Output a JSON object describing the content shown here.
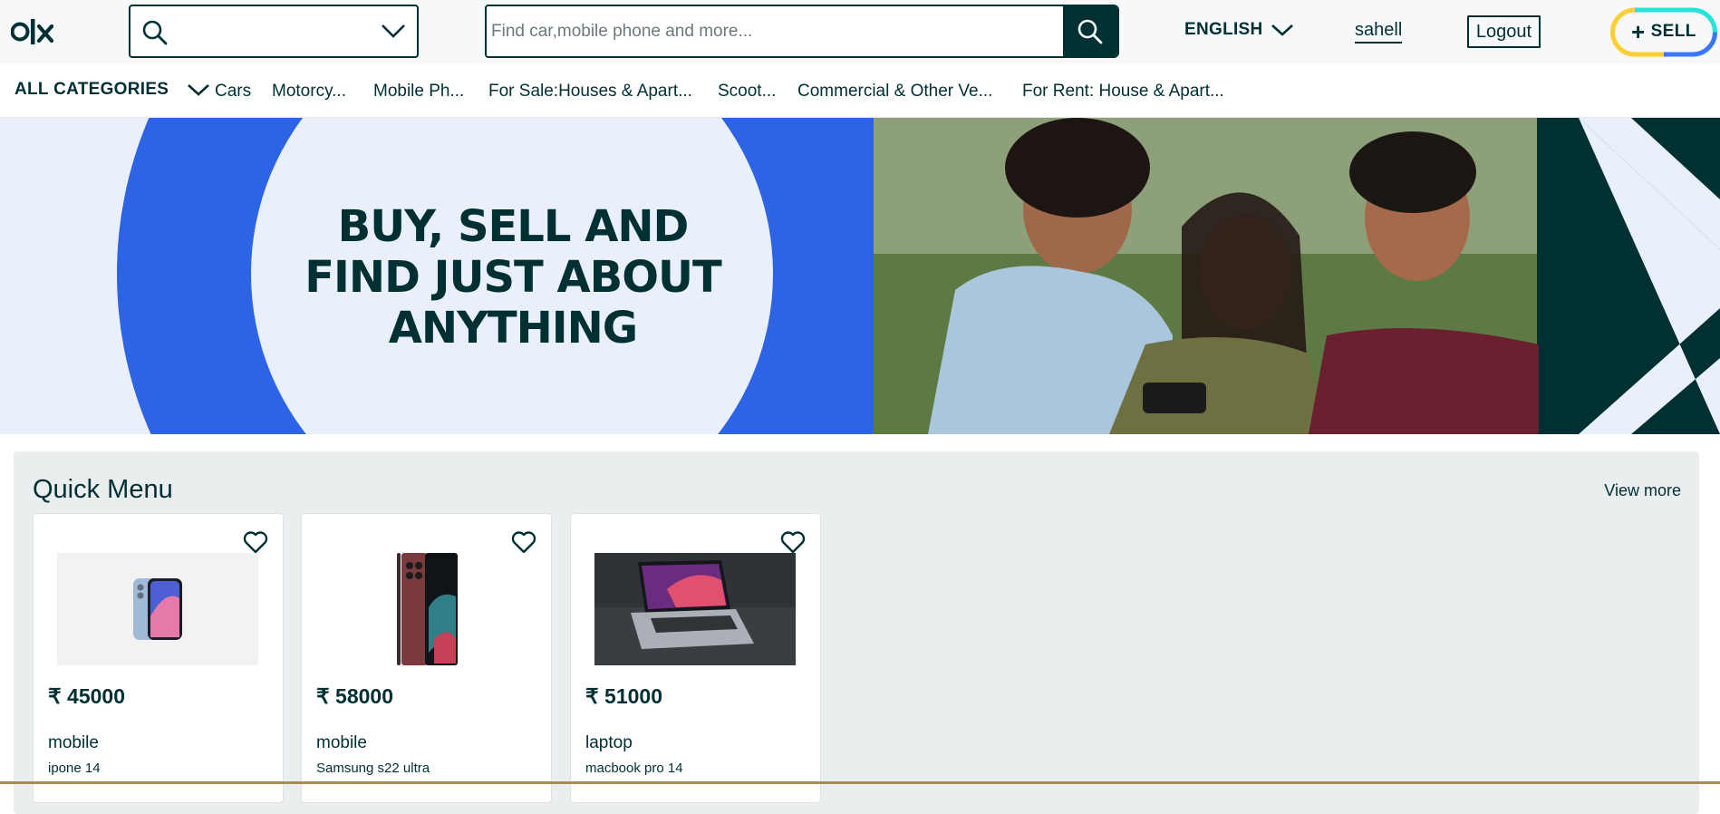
{
  "header": {
    "logo_text": "OLX",
    "location": {
      "value": "",
      "icons": [
        "search-icon",
        "chevron-down-icon"
      ]
    },
    "search": {
      "placeholder": "Find car,mobile phone and more...",
      "value": ""
    },
    "language": "ENGLISH",
    "username": "sahell",
    "logout_label": "Logout",
    "sell_label": "SELL"
  },
  "categories": {
    "all_label": "ALL CATEGORIES",
    "items": [
      "Cars",
      "Motorcy...",
      "Mobile Ph...",
      "For Sale:Houses & Apart...",
      "Scoot...",
      "Commercial & Other Ve...",
      "For Rent: House & Apart..."
    ]
  },
  "banner": {
    "line1": "BUY, SELL AND",
    "line2": "FIND JUST ABOUT",
    "line3": "ANYTHING"
  },
  "quick_menu": {
    "title": "Quick Menu",
    "view_more": "View more",
    "products": [
      {
        "price": "₹ 45000",
        "category": "mobile",
        "name": "ipone 14"
      },
      {
        "price": "₹ 58000",
        "category": "mobile",
        "name": "Samsung s22 ultra"
      },
      {
        "price": "₹ 51000",
        "category": "laptop",
        "name": "macbook pro 14"
      }
    ]
  },
  "colors": {
    "primary": "#002f34",
    "banner_blue": "#2d64e6",
    "banner_light": "#e9f0fc",
    "panel_bg": "#ebeeef",
    "sell_yellow": "#ffce32",
    "sell_cyan": "#23e5db",
    "sell_blue": "#3a77ff"
  }
}
